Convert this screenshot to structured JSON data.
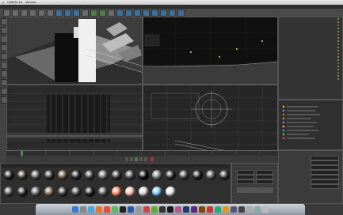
{
  "menubar": {
    "app_name": "CINEMA 4D",
    "items": [
      "Window"
    ],
    "clock": ""
  },
  "window_title": "",
  "viewports": {
    "top_left_label": "",
    "top_right_label": "",
    "bottom_left_label": "",
    "bottom_right_label": ""
  },
  "materials": {
    "swatches": [
      {
        "color": "#2a2a2a"
      },
      {
        "color": "#4a4038"
      },
      {
        "color": "#5a5a5a"
      },
      {
        "color": "#3a3a3a"
      },
      {
        "color": "#6b5a48"
      },
      {
        "color": "#2b2b2b"
      },
      {
        "color": "#444"
      },
      {
        "color": "#707070"
      },
      {
        "color": "#3f3f3f"
      },
      {
        "color": "#555"
      },
      {
        "color": "#111"
      },
      {
        "color": "#888"
      },
      {
        "color": "#333"
      },
      {
        "color": "#4d4d4d"
      },
      {
        "color": "#262626"
      },
      {
        "color": "#5e5e5e"
      },
      {
        "color": "#3a3a3a"
      },
      {
        "color": "#525252"
      },
      {
        "color": "#2e2e2e"
      },
      {
        "color": "#686868"
      },
      {
        "color": "#7a6a50"
      },
      {
        "color": "#3d3d3d"
      },
      {
        "color": "#4a4a4a"
      },
      {
        "color": "#222"
      },
      {
        "color": "#595959"
      },
      {
        "color": "#ff8f6a"
      },
      {
        "color": "#ffc7b0"
      },
      {
        "color": "#e0e0e0"
      },
      {
        "color": "#7fd0ff"
      },
      {
        "color": "#f2f2f2"
      }
    ]
  },
  "colors": {
    "accent_blue": "#3c6f9c",
    "accent_green": "#4a7f46",
    "background": "#3a3a3a"
  }
}
